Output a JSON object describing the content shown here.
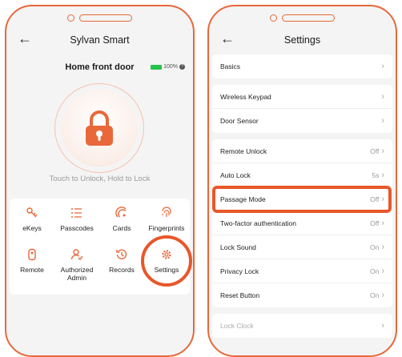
{
  "left_screen": {
    "title": "Sylvan Smart",
    "back_icon": "arrow-left-icon",
    "lock_name": "Home front door",
    "battery": "100%",
    "touch_hint": "Touch to Unlock, Hold to Lock",
    "grid": [
      {
        "label": "eKeys",
        "icon": "ekey-icon"
      },
      {
        "label": "Passcodes",
        "icon": "passcode-icon"
      },
      {
        "label": "Cards",
        "icon": "card-icon"
      },
      {
        "label": "Fingerprints",
        "icon": "fingerprint-icon"
      },
      {
        "label": "Remote",
        "icon": "remote-icon"
      },
      {
        "label": "Authorized Admin",
        "icon": "admin-icon"
      },
      {
        "label": "Records",
        "icon": "records-icon"
      },
      {
        "label": "Settings",
        "icon": "gear-icon"
      }
    ]
  },
  "right_screen": {
    "title": "Settings",
    "back_icon": "arrow-left-icon",
    "groups": [
      [
        {
          "label": "Basics",
          "value": ""
        }
      ],
      [
        {
          "label": "Wireless Keypad",
          "value": ""
        },
        {
          "label": "Door Sensor",
          "value": ""
        }
      ],
      [
        {
          "label": "Remote Unlock",
          "value": "Off"
        },
        {
          "label": "Auto Lock",
          "value": "5s"
        },
        {
          "label": "Passage Mode",
          "value": "Off"
        },
        {
          "label": "Two-factor authentication",
          "value": "Off"
        },
        {
          "label": "Lock Sound",
          "value": "On"
        },
        {
          "label": "Privacy Lock",
          "value": "On"
        },
        {
          "label": "Reset Button",
          "value": "On"
        }
      ],
      [
        {
          "label": "Lock Clock",
          "value": ""
        }
      ]
    ]
  },
  "colors": {
    "accent": "#e8683a",
    "highlight": "#e8572a",
    "battery": "#27c24c"
  }
}
